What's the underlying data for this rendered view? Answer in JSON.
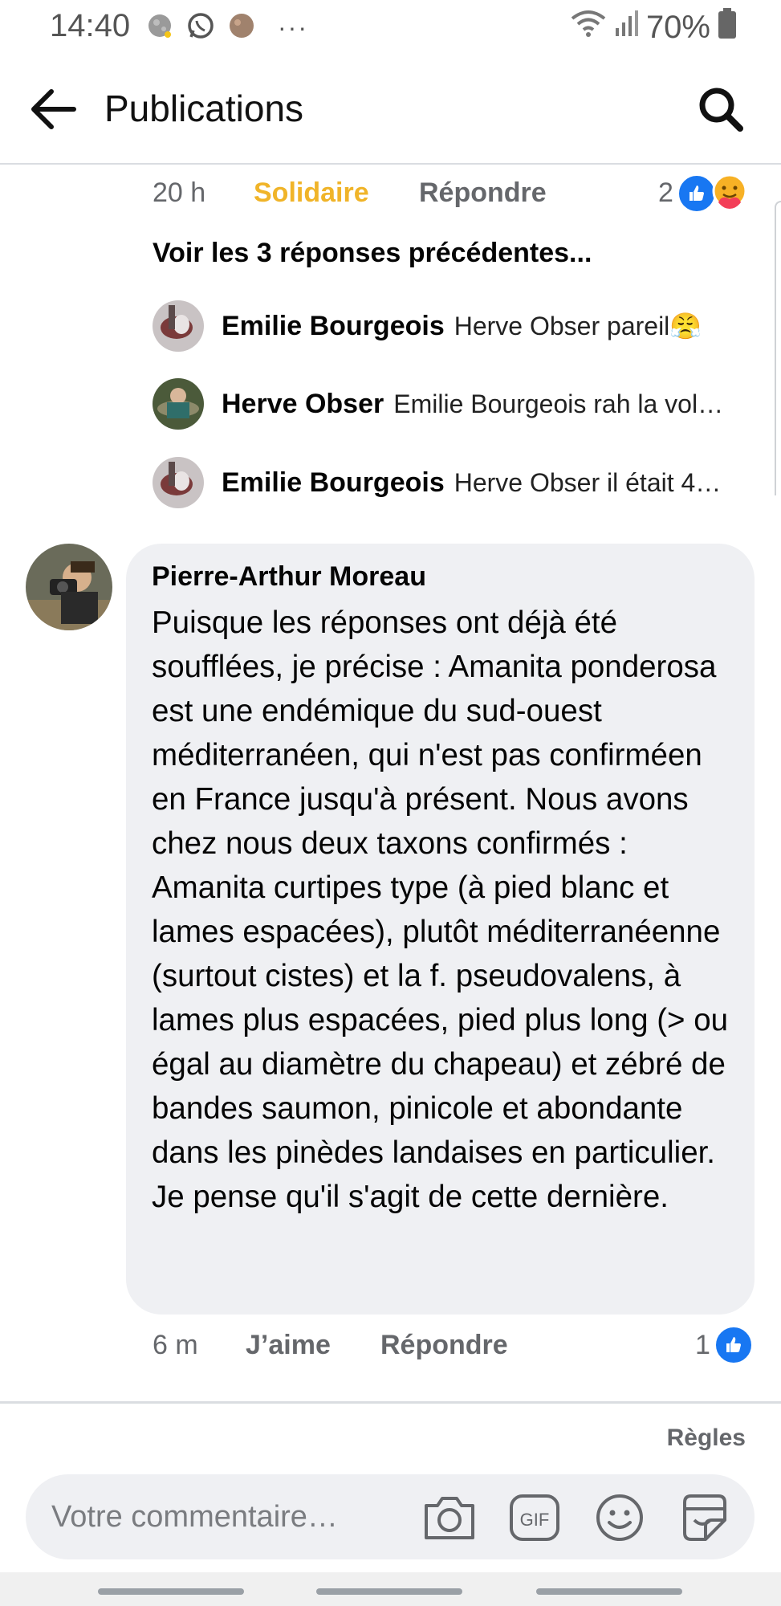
{
  "status_bar": {
    "time": "14:40",
    "battery": "70%",
    "more": "···",
    "icons": [
      "moon-icon",
      "whatsapp-icon",
      "app-icon",
      "wifi-icon",
      "signal-icon",
      "battery-icon"
    ]
  },
  "header": {
    "title": "Publications",
    "back_icon": "arrow-left-icon",
    "search_icon": "search-icon"
  },
  "previous_comment_actions": {
    "time": "20 h",
    "reaction_label": "Solidaire",
    "reply_label": "Répondre",
    "reaction_count": "2",
    "reaction_icons": [
      "like-icon",
      "care-icon"
    ]
  },
  "replies": {
    "view_previous": "Voir les 3 réponses précédentes...",
    "items": [
      {
        "name": "Emilie Bourgeois",
        "text": "Herve Obser pareil😤"
      },
      {
        "name": "Herve Obser",
        "text": "Emilie Bourgeois rah la vol…"
      },
      {
        "name": "Emilie Bourgeois",
        "text": "Herve Obser il était 4…"
      }
    ]
  },
  "comment": {
    "author": "Pierre-Arthur Moreau",
    "text": "Puisque les réponses ont déjà été soufflées, je précise : Amanita ponderosa est une endémique du sud-ouest méditerranéen, qui n'est pas confirméen en France jusqu'à présent. Nous avons chez nous deux taxons confirmés : Amanita curtipes type (à pied blanc et lames espacées), plutôt méditerranéenne (surtout cistes) et la f. pseudovalens, à lames plus espacées, pied plus long (> ou égal au diamètre du chapeau) et zébré de bandes saumon, pinicole et abondante dans les pinèdes landaises en particulier. Je pense qu'il s'agit de cette dernière.",
    "time": "6 m",
    "like_label": "J’aime",
    "reply_label": "Répondre",
    "like_count": "1"
  },
  "footer": {
    "rules": "Règles",
    "composer_placeholder": "Votre commentaire…",
    "gif_label": "GIF"
  },
  "colors": {
    "facebook_blue": "#1877f2",
    "solidaire_yellow": "#f0b429",
    "bubble_bg": "#eff0f3",
    "meta_gray": "#65676b"
  }
}
